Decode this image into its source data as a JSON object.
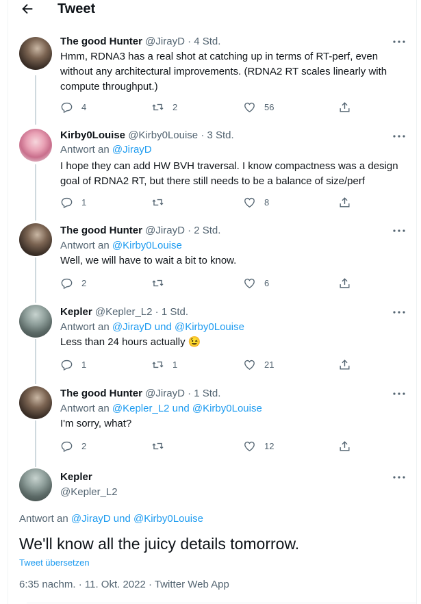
{
  "header": {
    "title": "Tweet"
  },
  "replies": [
    {
      "name": "The good Hunter",
      "handle": "@JirayD",
      "dot": "·",
      "time": "4 Std.",
      "reply_label": "",
      "reply_targets": "",
      "text": "Hmm, RDNA3 has a real shot at catching up in terms of RT-perf, even without any architectural improvements. (RDNA2 RT scales linearly with compute throughput.)",
      "replies": "4",
      "retweets": "2",
      "likes": "56"
    },
    {
      "name": "Kirby0Louise",
      "handle": "@Kirby0Louise",
      "dot": "·",
      "time": "3 Std.",
      "reply_label": "Antwort an",
      "reply_targets": "@JirayD",
      "text": "I hope they can add HW BVH traversal.  I know compactness was a design goal of RDNA2 RT, but there still needs to be a balance of size/perf",
      "replies": "1",
      "retweets": "",
      "likes": "8"
    },
    {
      "name": "The good Hunter",
      "handle": "@JirayD",
      "dot": "·",
      "time": "2 Std.",
      "reply_label": "Antwort an",
      "reply_targets": "@Kirby0Louise",
      "text": "Well, we will have to wait a bit to know.",
      "replies": "2",
      "retweets": "",
      "likes": "6"
    },
    {
      "name": "Kepler",
      "handle": "@Kepler_L2",
      "dot": "·",
      "time": "1 Std.",
      "reply_label": "Antwort an",
      "reply_targets": "@JirayD und @Kirby0Louise",
      "text": "Less than 24 hours actually 😉",
      "replies": "1",
      "retweets": "1",
      "likes": "21"
    },
    {
      "name": "The good Hunter",
      "handle": "@JirayD",
      "dot": "·",
      "time": "1 Std.",
      "reply_label": "Antwort an",
      "reply_targets": "@Kepler_L2 und @Kirby0Louise",
      "text": "I'm sorry, what?",
      "replies": "2",
      "retweets": "",
      "likes": "12"
    }
  ],
  "main_tweet": {
    "name": "Kepler",
    "handle": "@Kepler_L2",
    "reply_label": "Antwort an",
    "reply_targets": "@JirayD und @Kirby0Louise",
    "text": "We'll know all the juicy details tomorrow.",
    "translate": "Tweet übersetzen",
    "meta": "6:35 nachm. · 11. Okt. 2022 · Twitter Web App"
  },
  "colors": {
    "accent": "#1d9bf0",
    "secondary_text": "#536471",
    "text": "#0f1419",
    "thread_line": "#cfd9de"
  },
  "icons": [
    "back-arrow-icon",
    "more-icon",
    "reply-icon",
    "retweet-icon",
    "like-icon",
    "share-icon"
  ]
}
